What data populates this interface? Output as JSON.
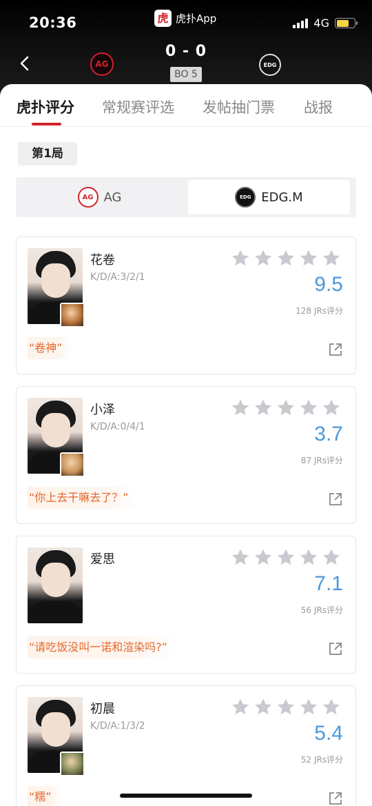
{
  "status_bar": {
    "time": "20:36",
    "app_name": "虎扑App",
    "app_logo_glyph": "虎",
    "network": "4G",
    "battery_level": 0.68,
    "battery_color": "#f7d547"
  },
  "match": {
    "score": "0 - 0",
    "format": "BO 5",
    "left_team_logo_text": "AG",
    "right_team_logo_text": "EDG"
  },
  "tabs": [
    {
      "label": "虎扑评分",
      "active": true
    },
    {
      "label": "常规赛评选",
      "active": false
    },
    {
      "label": "发帖抽门票",
      "active": false
    },
    {
      "label": "战报",
      "active": false
    }
  ],
  "game_label": "第1局",
  "team_switch": {
    "left": {
      "name": "AG",
      "logo_text": "AG",
      "selected": false
    },
    "right": {
      "name": "EDG.M",
      "logo_text": "EDG",
      "selected": true
    }
  },
  "players": [
    {
      "name": "花卷",
      "kda": "K/D/A:3/2/1",
      "rating": "9.5",
      "votes": "128 JRs评分",
      "quote": "“卷神”",
      "stars_filled": 0,
      "hero_color": "#b9733a"
    },
    {
      "name": "小泽",
      "kda": "K/D/A:0/4/1",
      "rating": "3.7",
      "votes": "87 JRs评分",
      "quote": "“你上去干嘛去了？”",
      "stars_filled": 0,
      "hero_color": "#c9935a"
    },
    {
      "name": "爱思",
      "kda": "",
      "rating": "7.1",
      "votes": "56 JRs评分",
      "quote": "“请吃饭没叫一诺和渲染吗?”",
      "stars_filled": 0,
      "hero_color": ""
    },
    {
      "name": "初晨",
      "kda": "K/D/A:1/3/2",
      "rating": "5.4",
      "votes": "52 JRs评分",
      "quote": "“糯”",
      "stars_filled": 0,
      "hero_color": "#7f8a5a"
    }
  ],
  "colors": {
    "accent_red": "#d0232a",
    "rating_blue": "#4c98dc",
    "quote_orange": "#e4672d",
    "star_gray": "#c9c9cf"
  },
  "icons": {
    "back": "chevron-left-icon",
    "share": "share-external-icon",
    "star": "star-icon"
  }
}
